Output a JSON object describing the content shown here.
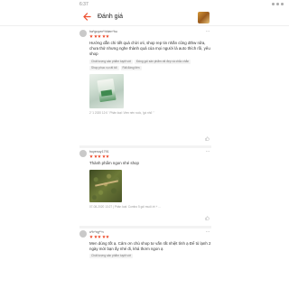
{
  "status": {
    "time": "6:37"
  },
  "header": {
    "title": "Đánh giá"
  },
  "reviews": [
    {
      "username": "ha*guyen*hhien*hu",
      "text": "Hướng dẫn chi tiết quá chời ơii, shop rep tin nhắn cũng dthw nữa, chưa thử nhưng nghe thành quả của mọi người là auto thích rồi, yêu shop",
      "tags": [
        "Chất lượng sản phẩm tuyệt vời",
        "Đóng gói sản phẩm rất đẹp và chắc chắn",
        "Shop phục vụ rất tốt",
        "Rất đáng tiền"
      ],
      "timestamp": "2 '1 2020 12:0 ' Phân loại: Vien nén ruốc, 'gà nhỏ ' '"
    },
    {
      "username": "huyenuy1791",
      "text": "Thành phẩm ngon nhé shop",
      "tags": [],
      "timestamp": "07-08-2020 13:27 | Phân loại: Combo 5 gói muối ớt + ..."
    },
    {
      "username": "u*b*ng**n",
      "text": "Men dùng tốt ạ. Cảm ơn chủ shop tư vấn rất nhiệt tình ạ Để tủ lạnh 2 ngày mới bạn ấy nhé đi, khá thơm ngon ạ",
      "tags": [
        "Chất lượng sản phẩm tuyệt vời"
      ],
      "timestamp": ""
    }
  ],
  "icons": {
    "back": "back-arrow-icon",
    "more": "more-dots-icon",
    "like": "thumbs-up-icon",
    "star": "star-icon"
  },
  "colors": {
    "accent": "#ee4d2d",
    "star": "#ee4d2d"
  }
}
